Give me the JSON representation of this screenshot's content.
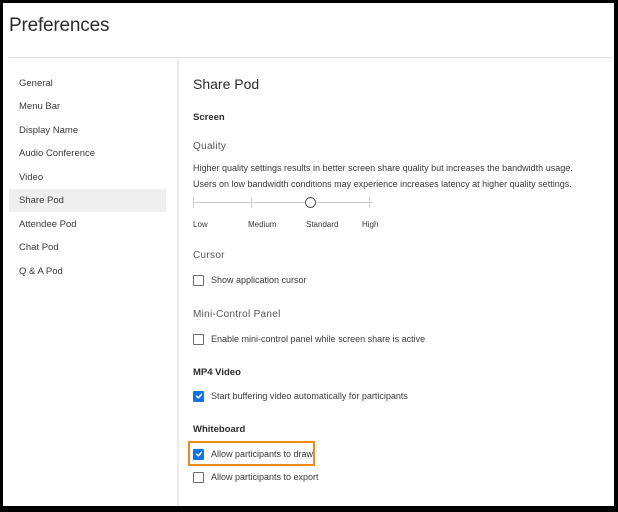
{
  "window": {
    "title": "Preferences"
  },
  "sidebar": {
    "items": [
      {
        "label": "General",
        "active": false
      },
      {
        "label": "Menu Bar",
        "active": false
      },
      {
        "label": "Display Name",
        "active": false
      },
      {
        "label": "Audio Conference",
        "active": false
      },
      {
        "label": "Video",
        "active": false
      },
      {
        "label": "Share Pod",
        "active": true
      },
      {
        "label": "Attendee Pod",
        "active": false
      },
      {
        "label": "Chat Pod",
        "active": false
      },
      {
        "label": "Q & A Pod",
        "active": false
      }
    ]
  },
  "content": {
    "title": "Share Pod",
    "screen": {
      "heading": "Screen",
      "quality": {
        "label": "Quality",
        "description_line1": "Higher quality settings results in better screen share quality but increases the bandwidth usage.",
        "description_line2": "Users on low bandwidth conditions may experience increases latency at higher quality settings.",
        "options": [
          "Low",
          "Medium",
          "Standard",
          "High"
        ],
        "selected": "Standard",
        "selected_index": 2
      }
    },
    "cursor": {
      "heading": "Cursor",
      "show_app_cursor": {
        "label": "Show application cursor",
        "checked": false
      }
    },
    "mini_control": {
      "heading": "Mini-Control Panel",
      "enable": {
        "label": "Enable mini-control panel while screen share is active",
        "checked": false
      }
    },
    "mp4_video": {
      "heading": "MP4 Video",
      "start_buffering": {
        "label": "Start buffering video automatically for participants",
        "checked": true
      }
    },
    "whiteboard": {
      "heading": "Whiteboard",
      "allow_draw": {
        "label": "Allow participants to draw",
        "checked": true,
        "highlighted": true
      },
      "allow_export": {
        "label": "Allow participants to export",
        "checked": false
      }
    }
  },
  "colors": {
    "accent": "#1473e6",
    "highlight": "#f08a1f",
    "active_item_bg": "#efefef"
  }
}
